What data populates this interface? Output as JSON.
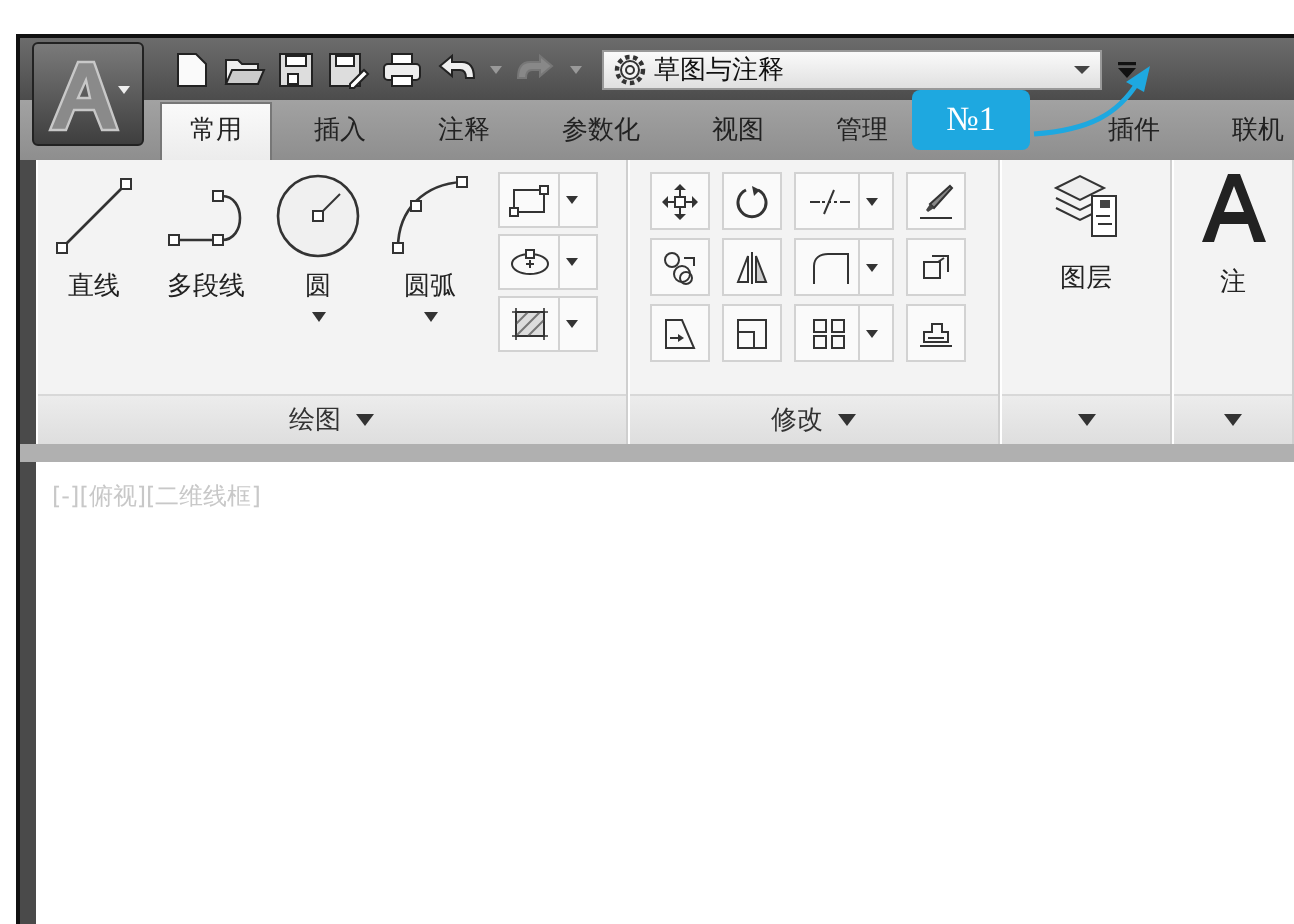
{
  "quick_access": {
    "workspace": "草图与注释"
  },
  "callout": {
    "label": "№1"
  },
  "tabs": [
    {
      "label": "常用",
      "selected": true
    },
    {
      "label": "插入",
      "selected": false
    },
    {
      "label": "注释",
      "selected": false
    },
    {
      "label": "参数化",
      "selected": false
    },
    {
      "label": "视图",
      "selected": false
    },
    {
      "label": "管理",
      "selected": false
    },
    {
      "label": "插件",
      "selected": false
    },
    {
      "label": "联机",
      "selected": false
    }
  ],
  "draw_panel": {
    "title": "绘图",
    "tools": [
      {
        "kind": "line",
        "label": "直线",
        "dropdown": false
      },
      {
        "kind": "polyline",
        "label": "多段线",
        "dropdown": false
      },
      {
        "kind": "circle",
        "label": "圆",
        "dropdown": true
      },
      {
        "kind": "arc",
        "label": "圆弧",
        "dropdown": true
      }
    ]
  },
  "modify_panel": {
    "title": "修改"
  },
  "layer_panel": {
    "label": "图层"
  },
  "annotation_panel": {
    "label": "注"
  },
  "viewport": {
    "label": "[-][俯视][二维线框]"
  }
}
